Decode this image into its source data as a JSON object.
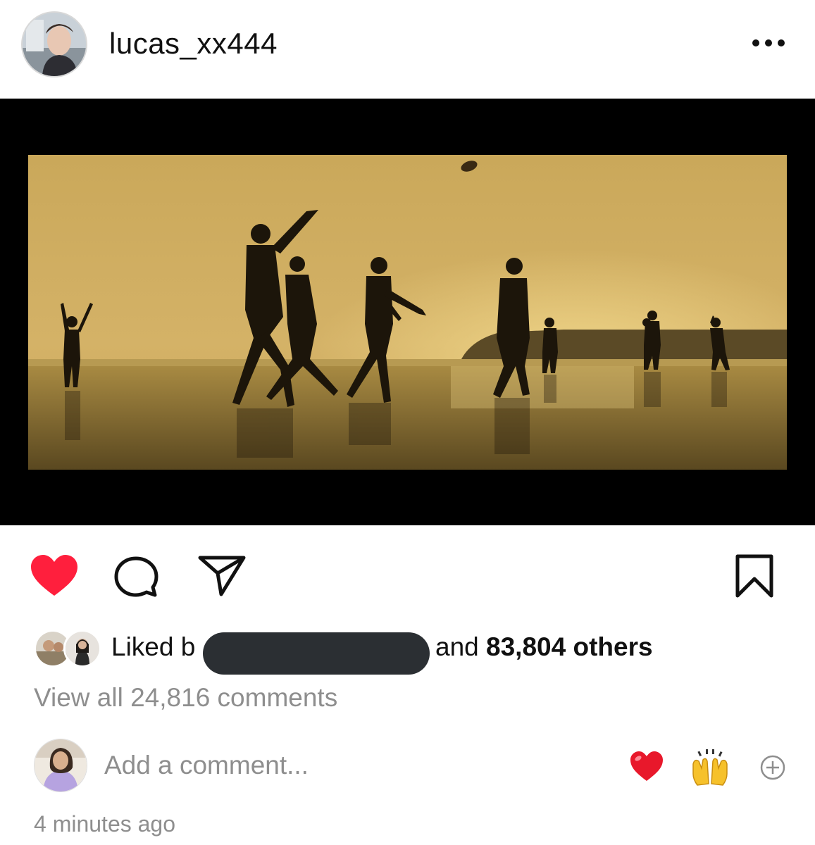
{
  "post": {
    "username": "lucas_xx444",
    "image_alt": "Silhouettes of people playing football on a beach at sunset"
  },
  "likes": {
    "prefix": "Liked b",
    "and": "and",
    "count": "83,804 others"
  },
  "comments": {
    "view_all": "View all 24,816 comments"
  },
  "compose": {
    "placeholder": "Add a comment...",
    "value": ""
  },
  "timestamp": "4 minutes ago",
  "colors": {
    "like_red": "#ff1f3d",
    "muted_text": "#8e8e8e",
    "redaction": "#2b2f33"
  },
  "icons": [
    "heart-icon",
    "comment-icon",
    "share-icon",
    "bookmark-icon",
    "more-icon",
    "add-icon"
  ]
}
